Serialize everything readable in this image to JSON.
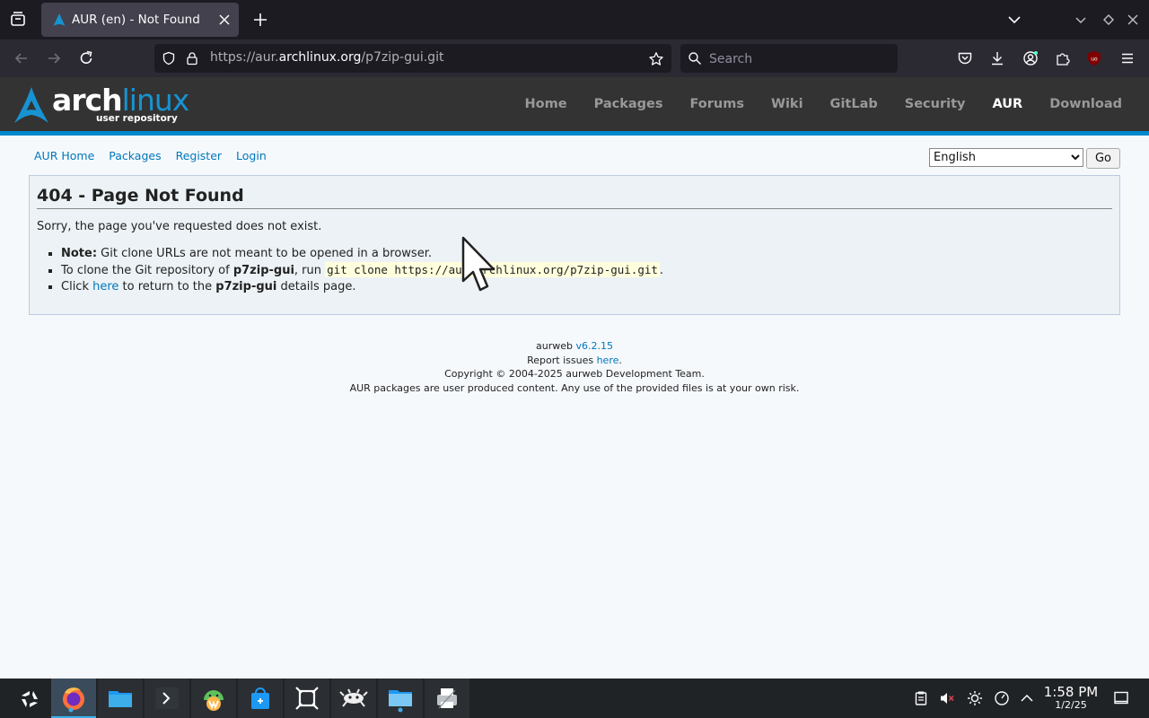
{
  "browser": {
    "tab_title": "AUR (en) - Not Found",
    "url_prefix": "https://aur.",
    "url_host": "archlinux.org",
    "url_path": "/p7zip-gui.git",
    "search_placeholder": "Search"
  },
  "header": {
    "logo_arch": "arch",
    "logo_linux": "linux",
    "logo_sub": "user repository",
    "nav": [
      "Home",
      "Packages",
      "Forums",
      "Wiki",
      "GitLab",
      "Security",
      "AUR",
      "Download"
    ],
    "accent": "#0088cc"
  },
  "subnav": {
    "items": [
      "AUR Home",
      "Packages",
      "Register",
      "Login"
    ],
    "language_selected": "English",
    "go_label": "Go"
  },
  "content": {
    "heading": "404 - Page Not Found",
    "lead": "Sorry, the page you've requested does not exist.",
    "note_label": "Note:",
    "note_text": " Git clone URLs are not meant to be opened in a browser.",
    "clone_pre": "To clone the Git repository of ",
    "package": "p7zip-gui",
    "clone_mid": ", run ",
    "clone_cmd": "git clone https://aur.archlinux.org/p7zip-gui.git",
    "clone_post": ".",
    "click_pre": "Click ",
    "click_link": "here",
    "click_mid": " to return to the ",
    "click_post": " details page."
  },
  "footer": {
    "aurweb": "aurweb ",
    "version": "v6.2.15",
    "report_pre": "Report issues ",
    "report_link": "here",
    "report_post": ".",
    "copyright": "Copyright © 2004-2025 aurweb Development Team.",
    "disclaimer": "AUR packages are user produced content. Any use of the provided files is at your own risk."
  },
  "taskbar": {
    "time": "1:58 PM",
    "date": "1/2/25"
  }
}
